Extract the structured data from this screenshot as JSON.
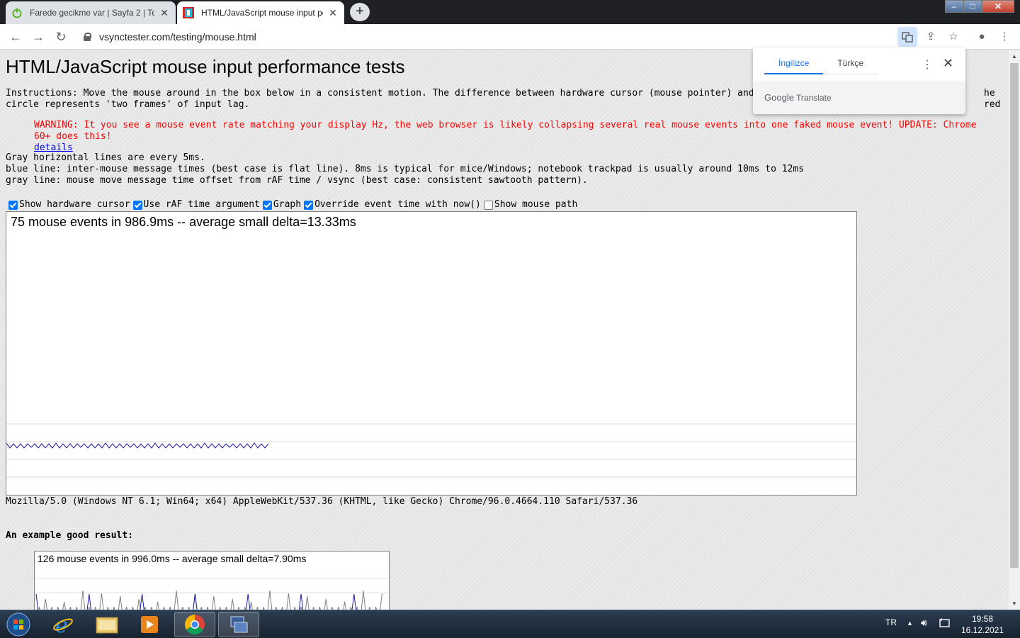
{
  "browser": {
    "tabs": [
      {
        "title": "Farede gecikme var | Sayfa 2 | Tec",
        "active": false,
        "icon": "power-favicon-icon"
      },
      {
        "title": "HTML/JavaScript mouse input pe",
        "active": true,
        "icon": "vsync-favicon-icon"
      }
    ],
    "new_tab_label": "+",
    "url": "vsynctester.com/testing/mouse.html",
    "window_controls": {
      "minimize": "–",
      "maximize": "□",
      "close": "✕"
    }
  },
  "page": {
    "title": "HTML/JavaScript mouse input performance tests",
    "instructions_prefix": "Instructions: Move the mouse around in the box below in a consistent motion. The difference between hardware cursor (mouse pointer) and last recorded m",
    "instructions_right": "he red",
    "instructions_line2": "circle represents 'two frames' of input lag.",
    "warning_text": "WARNING: It you see a mouse event rate matching your display Hz, the web browser is likely collapsing several real mouse events into one faked mouse event! UPDATE: Chrome 60+ does this!",
    "warning_link": "details",
    "notes": [
      "Gray horizontal lines are every 5ms.",
      "blue line: inter-mouse message times (best case is flat line). 8ms is typical for mice/Windows; notebook trackpad is usually around 10ms to 12ms",
      "gray line: mouse move message time offset from rAF time / vsync (best case: consistent sawtooth pattern)."
    ],
    "options": [
      {
        "label": "Show hardware cursor",
        "checked": true
      },
      {
        "label": "Use rAF time argument",
        "checked": true
      },
      {
        "label": "Graph",
        "checked": true
      },
      {
        "label": "Override event time with now()",
        "checked": true
      },
      {
        "label": "Show mouse path",
        "checked": false
      }
    ],
    "canvas_status": "75 mouse events in 986.9ms -- average small delta=13.33ms",
    "user_agent": "Mozilla/5.0 (Windows NT 6.1; Win64; x64) AppleWebKit/537.36 (KHTML, like Gecko) Chrome/96.0.4664.110 Safari/537.36",
    "example_heading": "An example good result:",
    "example_status": "126 mouse events in 996.0ms -- average small delta=7.90ms"
  },
  "translate_popup": {
    "languages": [
      {
        "label": "İngilizce",
        "selected": true
      },
      {
        "label": "Türkçe",
        "selected": false
      }
    ],
    "brand_google": "Google",
    "brand_translate": "Translate"
  },
  "taskbar": {
    "language": "TR",
    "time": "19:58",
    "date": "16.12.2021"
  },
  "colors": {
    "warning": "#ff0000",
    "link": "#0000ee",
    "graph_line": "#1a1aa6",
    "checkbox": "#0075ff",
    "translate_accent": "#1a73e8"
  }
}
